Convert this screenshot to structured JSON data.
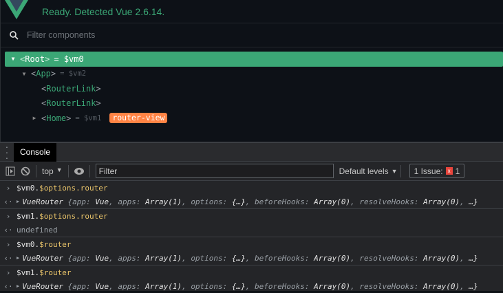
{
  "header": {
    "status": "Ready. Detected Vue 2.6.14."
  },
  "search": {
    "placeholder": "Filter components"
  },
  "tree": [
    {
      "name": "Root",
      "ref": "= $vm0",
      "expanded": true,
      "selected": true
    },
    {
      "name": "App",
      "ref": "= $vm2",
      "expanded": true
    },
    {
      "name": "RouterLink"
    },
    {
      "name": "RouterLink"
    },
    {
      "name": "Home",
      "ref": "= $vm1",
      "collapsed": true,
      "tag": "router-view"
    }
  ],
  "console": {
    "tab": "Console",
    "context": "top",
    "filter_placeholder": "Filter",
    "levels": "Default levels",
    "issues_label": "1 Issue:",
    "issues_count": "1",
    "entries": [
      {
        "obj": "$vm0.",
        "prop": "$options.router",
        "result": "object"
      },
      {
        "obj": "$vm1.",
        "prop": "$options.router",
        "result": "undefined"
      },
      {
        "obj": "$vm0.",
        "prop": "$router",
        "result": "object"
      },
      {
        "obj": "$vm1.",
        "prop": "$router",
        "result": "object"
      }
    ],
    "preview": {
      "cls": "VueRouter",
      "open": "{",
      "k1": "app",
      "v1": "Vue",
      "k2": "apps",
      "v2": "Array(1)",
      "k3": "options",
      "v3": "{…}",
      "k4": "beforeHooks",
      "v4": "Array(0)",
      "k5": "resolveHooks",
      "v5": "Array(0)",
      "end": "…}"
    },
    "undefined": "undefined"
  }
}
